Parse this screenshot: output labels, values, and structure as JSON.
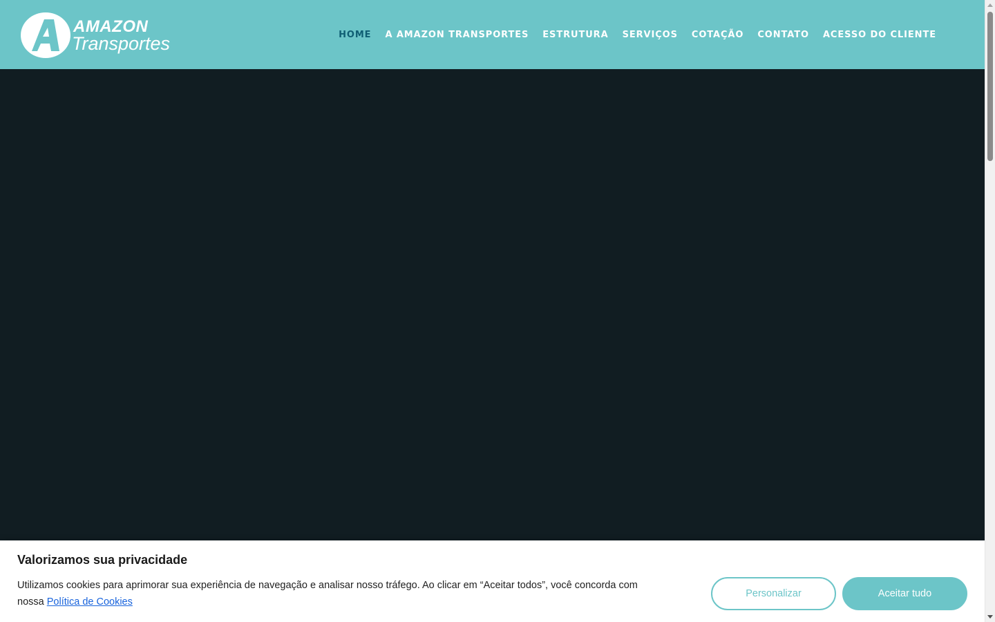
{
  "brand": {
    "name_line1": "AMAZON",
    "name_line2": "Transportes",
    "primary_color": "#6cc5c8",
    "active_nav_color": "#0f5e73",
    "hero_color": "#111d22"
  },
  "nav": {
    "items": [
      {
        "label": "HOME",
        "active": true
      },
      {
        "label": "A AMAZON TRANSPORTES",
        "active": false
      },
      {
        "label": "ESTRUTURA",
        "active": false
      },
      {
        "label": "SERVIÇOS",
        "active": false
      },
      {
        "label": "COTAÇÃO",
        "active": false
      },
      {
        "label": "CONTATO",
        "active": false
      },
      {
        "label": "ACESSO DO CLIENTE",
        "active": false
      }
    ]
  },
  "cookie": {
    "title": "Valorizamos sua privacidade",
    "text": "Utilizamos cookies para aprimorar sua experiência de navegação e analisar nosso tráfego. Ao clicar em “Aceitar todos”, você concorda com nossa",
    "link_label": "Política de Cookies",
    "customize_label": "Personalizar",
    "accept_label": "Aceitar tudo"
  }
}
